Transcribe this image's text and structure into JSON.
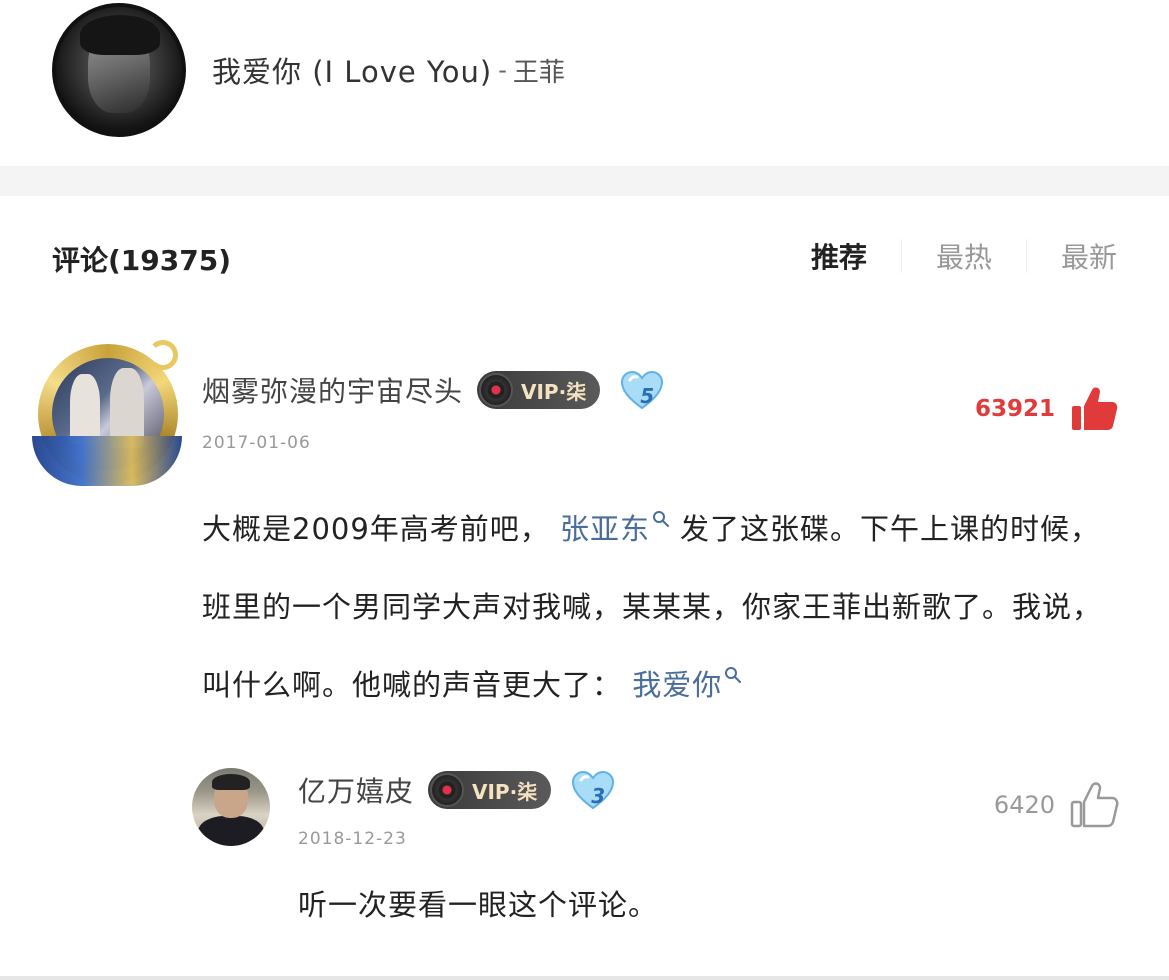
{
  "song": {
    "title": "我爱你 (I Love You)",
    "separator": "-",
    "artist": "王菲",
    "cover_icon": "album-cover"
  },
  "comments_header": {
    "title": "评论(19375)",
    "tabs": [
      {
        "label": "推荐",
        "active": true
      },
      {
        "label": "最热",
        "active": false
      },
      {
        "label": "最新",
        "active": false
      }
    ]
  },
  "main_comment": {
    "username": "烟雾弥漫的宇宙尽头",
    "vip_label": "VIP·柒",
    "level": "5",
    "date": "2017-01-06",
    "like_count": "63921",
    "liked": true,
    "text_parts": {
      "p1": "大概是2009年高考前吧，",
      "link1": "张亚东",
      "p2": "发了这张碟。下午上课的时候，班里的一个男同学大声对我喊，某某某，你家王菲出新歌了。我说，叫什么啊。他喊的声音更大了：",
      "link2": "我爱你"
    }
  },
  "reply": {
    "username": "亿万嬉皮",
    "vip_label": "VIP·柒",
    "level": "3",
    "date": "2018-12-23",
    "like_count": "6420",
    "liked": false,
    "text": "听一次要看一眼这个评论。"
  },
  "colors": {
    "liked_red": "#e03a3a",
    "link_blue": "#4a6d9a",
    "muted_gray": "#999999"
  }
}
